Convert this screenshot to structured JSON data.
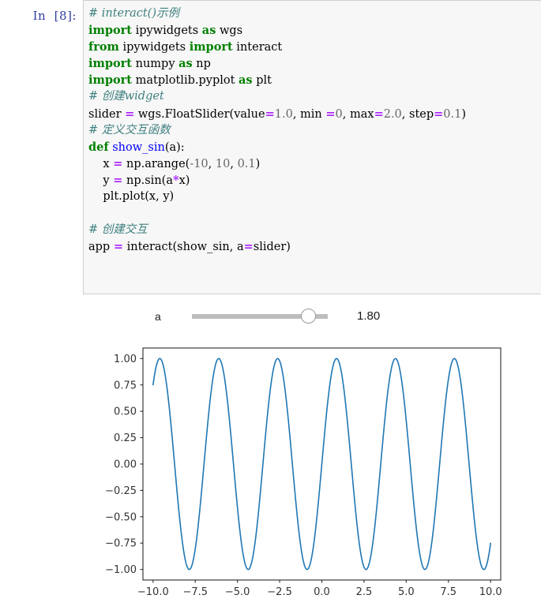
{
  "notebook": {
    "prompt_label": "In  [8]:",
    "code_lines": [
      {
        "tokens": [
          {
            "t": "# interact()示例",
            "c": "cm"
          }
        ]
      },
      {
        "tokens": [
          {
            "t": "import",
            "c": "kw"
          },
          {
            "t": " ipywidgets ",
            "c": "pl"
          },
          {
            "t": "as",
            "c": "kw"
          },
          {
            "t": " wgs",
            "c": "pl"
          }
        ]
      },
      {
        "tokens": [
          {
            "t": "from",
            "c": "kw"
          },
          {
            "t": " ipywidgets ",
            "c": "pl"
          },
          {
            "t": "import",
            "c": "kw"
          },
          {
            "t": " interact",
            "c": "pl"
          }
        ]
      },
      {
        "tokens": [
          {
            "t": "import",
            "c": "kw"
          },
          {
            "t": " numpy ",
            "c": "pl"
          },
          {
            "t": "as",
            "c": "kw"
          },
          {
            "t": " np",
            "c": "pl"
          }
        ]
      },
      {
        "tokens": [
          {
            "t": "import",
            "c": "kw"
          },
          {
            "t": " matplotlib.pyplot ",
            "c": "pl"
          },
          {
            "t": "as",
            "c": "kw"
          },
          {
            "t": " plt",
            "c": "pl"
          }
        ]
      },
      {
        "tokens": [
          {
            "t": "# 创建widget",
            "c": "cm"
          }
        ]
      },
      {
        "tokens": [
          {
            "t": "slider ",
            "c": "pl"
          },
          {
            "t": "=",
            "c": "opr"
          },
          {
            "t": " wgs.FloatSlider(value",
            "c": "pl"
          },
          {
            "t": "=",
            "c": "opr"
          },
          {
            "t": "1.0",
            "c": "num"
          },
          {
            "t": ", min ",
            "c": "pl"
          },
          {
            "t": "=",
            "c": "opr"
          },
          {
            "t": "0",
            "c": "num"
          },
          {
            "t": ", max",
            "c": "pl"
          },
          {
            "t": "=",
            "c": "opr"
          },
          {
            "t": "2.0",
            "c": "num"
          },
          {
            "t": ", step",
            "c": "pl"
          },
          {
            "t": "=",
            "c": "opr"
          },
          {
            "t": "0.1",
            "c": "num"
          },
          {
            "t": ")",
            "c": "pl"
          }
        ]
      },
      {
        "tokens": [
          {
            "t": "# 定义交互函数",
            "c": "cm"
          }
        ]
      },
      {
        "tokens": [
          {
            "t": "def",
            "c": "kw"
          },
          {
            "t": " ",
            "c": "pl"
          },
          {
            "t": "show_sin",
            "c": "fn"
          },
          {
            "t": "(a):",
            "c": "pl"
          }
        ]
      },
      {
        "tokens": [
          {
            "t": "    x ",
            "c": "pl"
          },
          {
            "t": "=",
            "c": "opr"
          },
          {
            "t": " np.arange(",
            "c": "pl"
          },
          {
            "t": "-10",
            "c": "num"
          },
          {
            "t": ", ",
            "c": "pl"
          },
          {
            "t": "10",
            "c": "num"
          },
          {
            "t": ", ",
            "c": "pl"
          },
          {
            "t": "0.1",
            "c": "num"
          },
          {
            "t": ")",
            "c": "pl"
          }
        ]
      },
      {
        "tokens": [
          {
            "t": "    y ",
            "c": "pl"
          },
          {
            "t": "=",
            "c": "opr"
          },
          {
            "t": " np.sin(a",
            "c": "pl"
          },
          {
            "t": "*",
            "c": "opr"
          },
          {
            "t": "x)",
            "c": "pl"
          }
        ]
      },
      {
        "tokens": [
          {
            "t": "    plt.plot(x, y)",
            "c": "pl"
          }
        ]
      },
      {
        "tokens": []
      },
      {
        "tokens": [
          {
            "t": "# 创建交互",
            "c": "cm"
          }
        ]
      },
      {
        "tokens": [
          {
            "t": "app ",
            "c": "pl"
          },
          {
            "t": "=",
            "c": "opr"
          },
          {
            "t": " interact(show_sin, a",
            "c": "pl"
          },
          {
            "t": "=",
            "c": "opr"
          },
          {
            "t": "slider)",
            "c": "pl"
          }
        ]
      }
    ]
  },
  "slider": {
    "label": "a",
    "value_text": "1.80",
    "value": 1.8,
    "min": 0,
    "max": 2.0,
    "step": 0.1,
    "fill_ratio": 0.9,
    "track_color": "#bdbdbd",
    "handle_color": "#ffffff"
  },
  "chart_data": {
    "type": "line",
    "title": "",
    "xlabel": "",
    "ylabel": "",
    "xlim": [
      -10.6,
      10.6
    ],
    "ylim": [
      -1.1,
      1.1
    ],
    "grid": false,
    "legend": "none",
    "line_color": "#1f77b4",
    "line_width": 1.6,
    "xticks": [
      -10.0,
      -7.5,
      -5.0,
      -2.5,
      0.0,
      2.5,
      5.0,
      7.5,
      10.0
    ],
    "xticklabels": [
      "−10.0",
      "−7.5",
      "−5.0",
      "−2.5",
      "0.0",
      "2.5",
      "5.0",
      "7.5",
      "10.0"
    ],
    "yticks": [
      1.0,
      0.75,
      0.5,
      0.25,
      0.0,
      -0.25,
      -0.5,
      -0.75,
      -1.0
    ],
    "yticklabels": [
      "1.00",
      "0.75",
      "0.50",
      "0.25",
      "0.00",
      "−0.25",
      "−0.50",
      "−0.75",
      "−1.00"
    ],
    "series": [
      {
        "name": "sin(a*x)",
        "function": "sin(1.8*x)",
        "amplitude": 1.0,
        "frequency": 1.8,
        "x_start": -10.0,
        "x_end": 10.0,
        "x_step": 0.1,
        "y_at_x_start": 0.751
      }
    ]
  }
}
